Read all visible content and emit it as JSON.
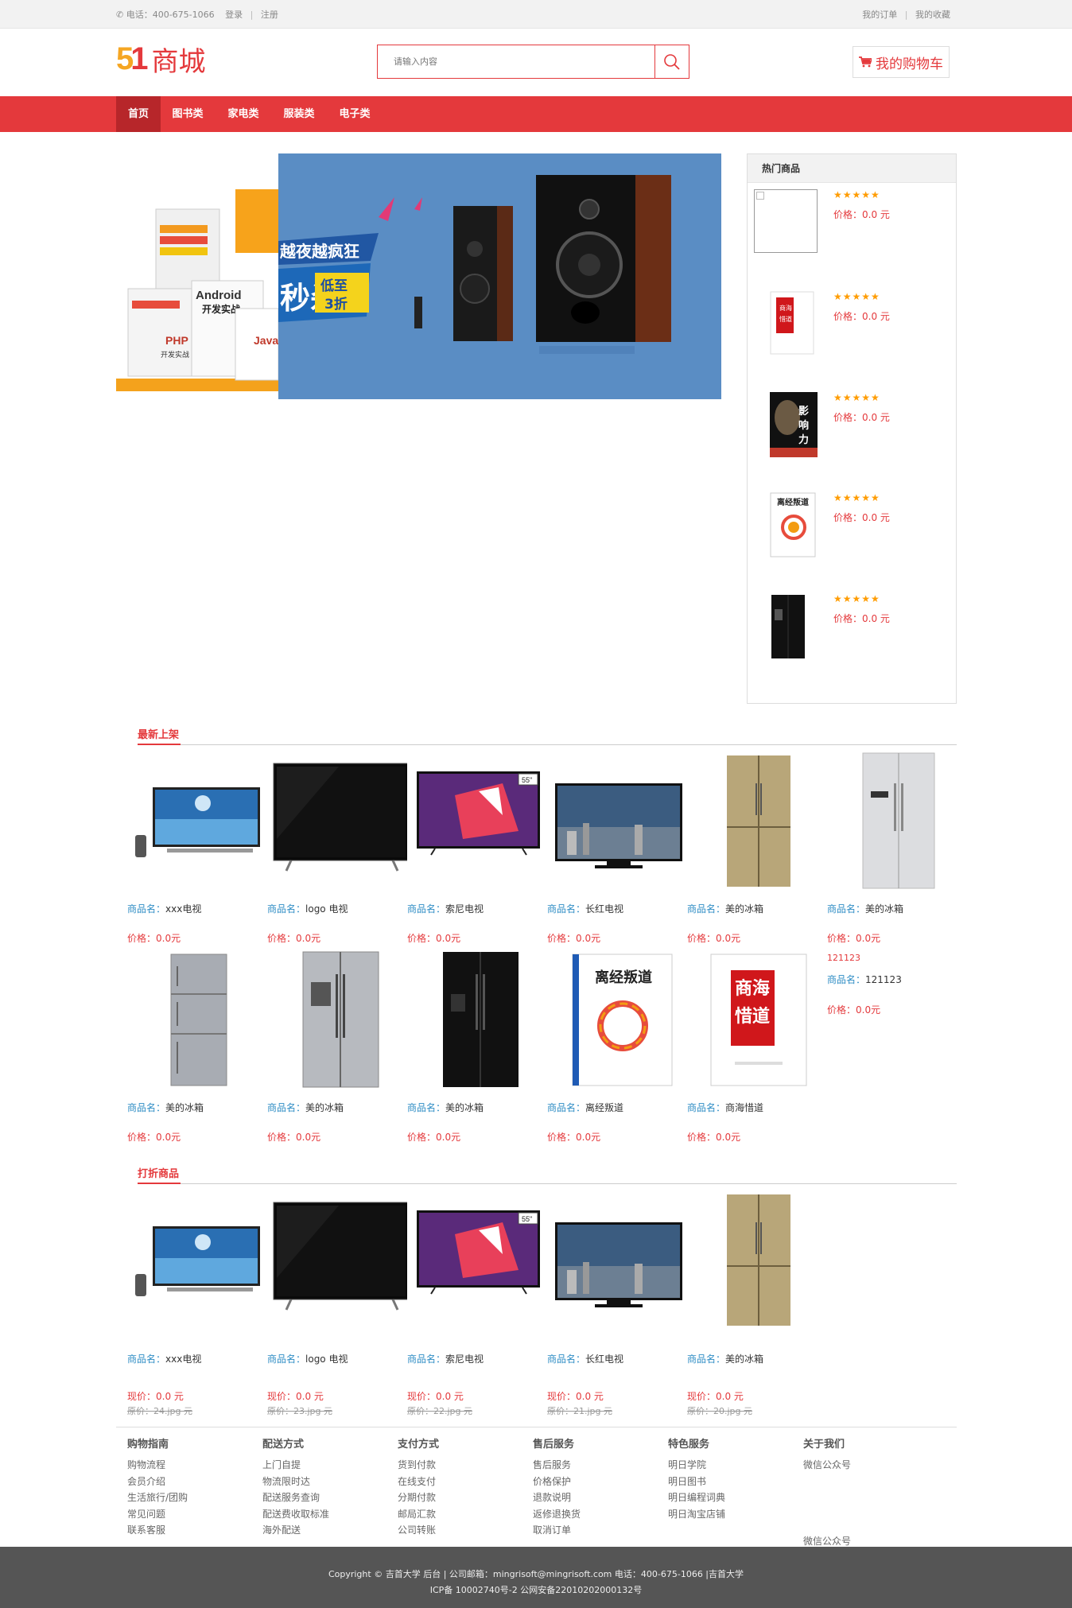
{
  "topbar": {
    "phone": "电话：400-675-1066",
    "login": "登录",
    "register": "注册",
    "my_orders": "我的订单",
    "my_favorites": "我的收藏"
  },
  "header": {
    "logo_number": "51",
    "logo_text": "商城",
    "search_placeholder": "请输入内容",
    "cart_label": "我的购物车"
  },
  "nav": {
    "items": [
      "首页",
      "图书类",
      "家电类",
      "服装类",
      "电子类"
    ]
  },
  "banner": {
    "left_book_1": "Android开发实战",
    "left_book_2": "PHP开发实战",
    "left_book_3": "Java开发实战",
    "slogan_1": "越夜越疯狂",
    "slogan_2": "秒杀",
    "slogan_3": "低至3折"
  },
  "hot": {
    "title": "热门商品",
    "items": [
      {
        "rating": 5,
        "price_label": "价格：",
        "price": "0.0 元"
      },
      {
        "rating": 5,
        "price_label": "价格：",
        "price": "0.0 元",
        "cover": "商海惜道"
      },
      {
        "rating": 5,
        "price_label": "价格：",
        "price": "0.0 元",
        "cover": "影响力"
      },
      {
        "rating": 5,
        "price_label": "价格：",
        "price": "0.0 元",
        "cover": "离经叛道"
      },
      {
        "rating": 5,
        "price_label": "价格：",
        "price": "0.0 元"
      }
    ]
  },
  "newest": {
    "title": "最新上架",
    "name_label": "商品名：",
    "price_label": "价格：",
    "items": [
      {
        "name": "xxx电视",
        "price": "0.0元",
        "kind": "tv1"
      },
      {
        "name": "logo 电视",
        "price": "0.0元",
        "kind": "tv2"
      },
      {
        "name": "索尼电视",
        "price": "0.0元",
        "kind": "tv3",
        "badge": "55\""
      },
      {
        "name": "长红电视",
        "price": "0.0元",
        "kind": "tv4"
      },
      {
        "name": "美的冰箱",
        "price": "0.0元",
        "kind": "fridge-gold"
      },
      {
        "name": "美的冰箱",
        "price": "0.0元",
        "kind": "fridge-silver"
      },
      {
        "name": "美的冰箱",
        "price": "0.0元",
        "kind": "fridge-3door"
      },
      {
        "name": "美的冰箱",
        "price": "0.0元",
        "kind": "fridge-steel"
      },
      {
        "name": "美的冰箱",
        "price": "0.0元",
        "kind": "fridge-black"
      },
      {
        "name": "离经叛道",
        "price": "0.0元",
        "kind": "book-lijing",
        "cover": "离经叛道"
      },
      {
        "name": "商海惜道",
        "price": "0.0元",
        "kind": "book-shanghai",
        "cover": "商海惜道"
      }
    ],
    "extra": {
      "broken_alt": "121123",
      "name": "121123",
      "price": "0.0元"
    }
  },
  "discount": {
    "title": "打折商品",
    "name_label": "商品名：",
    "now_label": "现价：",
    "orig_label": "原价：",
    "items": [
      {
        "name": "xxx电视",
        "now": "0.0 元",
        "orig": "24.jpg 元",
        "kind": "tv1"
      },
      {
        "name": "logo 电视",
        "now": "0.0 元",
        "orig": "23.jpg 元",
        "kind": "tv2"
      },
      {
        "name": "索尼电视",
        "now": "0.0 元",
        "orig": "22.jpg 元",
        "kind": "tv3",
        "badge": "55\""
      },
      {
        "name": "长红电视",
        "now": "0.0 元",
        "orig": "21.jpg 元",
        "kind": "tv4"
      },
      {
        "name": "美的冰箱",
        "now": "0.0 元",
        "orig": "20.jpg 元",
        "kind": "fridge-gold"
      }
    ]
  },
  "footer": {
    "columns": [
      {
        "title": "购物指南",
        "items": [
          "购物流程",
          "会员介绍",
          "生活旅行/团购",
          "常见问题",
          "联系客服"
        ]
      },
      {
        "title": "配送方式",
        "items": [
          "上门自提",
          "物流限时达",
          "配送服务查询",
          "配送费收取标准",
          "海外配送"
        ]
      },
      {
        "title": "支付方式",
        "items": [
          "货到付款",
          "在线支付",
          "分期付款",
          "邮局汇款",
          "公司转账"
        ]
      },
      {
        "title": "售后服务",
        "items": [
          "售后服务",
          "价格保护",
          "退款说明",
          "返修退换货",
          "取消订单"
        ]
      },
      {
        "title": "特色服务",
        "items": [
          "明日学院",
          "明日图书",
          "明日编程词典",
          "明日淘宝店铺"
        ]
      },
      {
        "title": "关于我们",
        "items": [
          "微信公众号"
        ],
        "bottom_item": "微信公众号"
      }
    ],
    "copyright": "Copyright © 吉首大学 后台 | 公司邮箱：mingrisoft@mingrisoft.com   电话：400-675-1066 |吉首大学",
    "icp": "ICP备 10002740号-2 公网安备22010202000132号"
  },
  "colors": {
    "brand_red": "#e4393c",
    "nav_active": "#b7262a",
    "label_blue": "#2f8dc5",
    "star_orange": "#ff9c00"
  }
}
